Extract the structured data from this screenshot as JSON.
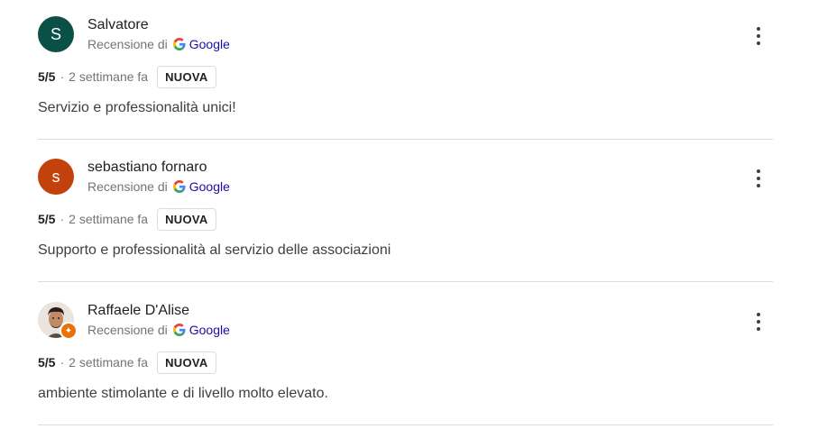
{
  "reviews": [
    {
      "author": "Salvatore",
      "initial": "S",
      "avatar_color": "#0b5046",
      "source_prefix": "Recensione di",
      "source_name": "Google",
      "rating": "5/5",
      "separator": "·",
      "time_ago": "2 settimane fa",
      "badge": "NUOVA",
      "text": "Servizio e professionalità unici!"
    },
    {
      "author": "sebastiano fornaro",
      "initial": "s",
      "avatar_color": "#c2410c",
      "source_prefix": "Recensione di",
      "source_name": "Google",
      "rating": "5/5",
      "separator": "·",
      "time_ago": "2 settimane fa",
      "badge": "NUOVA",
      "text": "Supporto e professionalità al servizio delle associazioni"
    },
    {
      "author": "Raffaele D'Alise",
      "initial": "",
      "avatar_color": "#e8e2dc",
      "source_prefix": "Recensione di",
      "source_name": "Google",
      "rating": "5/5",
      "separator": "·",
      "time_ago": "2 settimane fa",
      "badge": "NUOVA",
      "text": "ambiente stimolante e di livello molto elevato."
    }
  ],
  "icons": {
    "google": "google-g-logo-icon",
    "menu": "more-vert-icon",
    "local_guide": "local-guide-badge-icon"
  },
  "colors": {
    "divider": "#dadce0",
    "google_link": "#1a0dab",
    "local_guide": "#e8710a"
  }
}
